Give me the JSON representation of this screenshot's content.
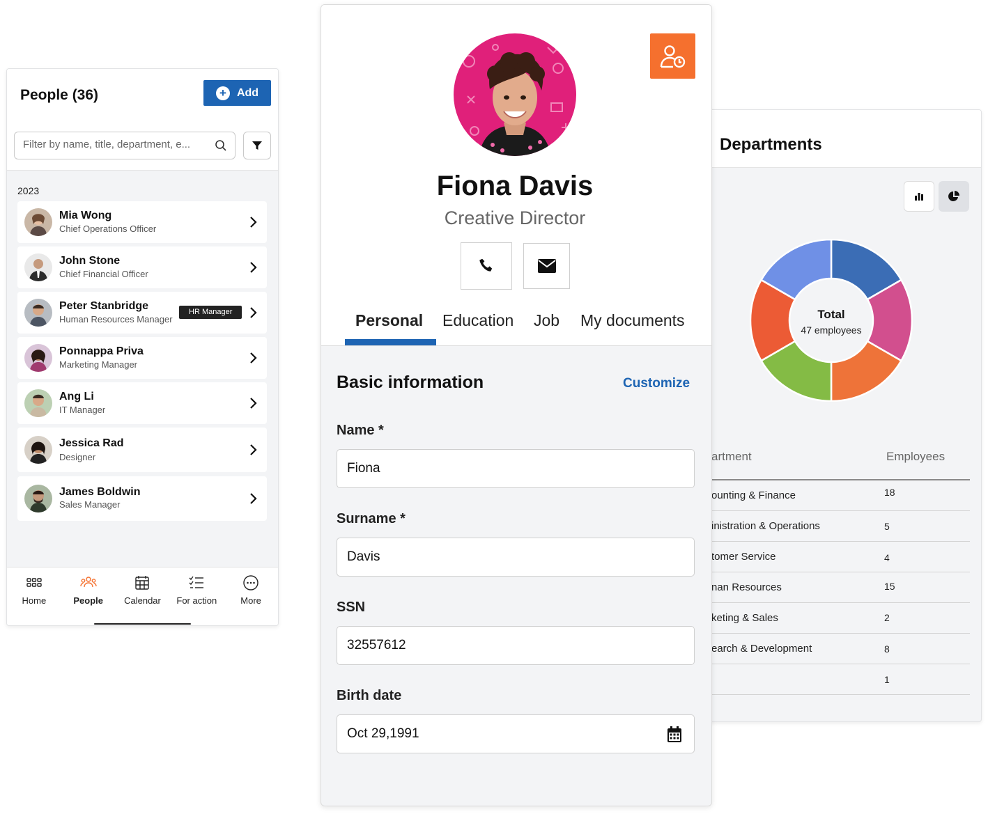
{
  "people": {
    "title": "People (36)",
    "add_label": "Add",
    "filter_placeholder": "Filter by name, title, department, e...",
    "group_year": "2023",
    "items": [
      {
        "name": "Mia Wong",
        "role": "Chief Operations Officer",
        "badge": ""
      },
      {
        "name": "John Stone",
        "role": "Chief Financial Officer",
        "badge": ""
      },
      {
        "name": "Peter Stanbridge",
        "role": "Human Resources Manager",
        "badge": "HR Manager"
      },
      {
        "name": "Ponnappa Priva",
        "role": "Marketing Manager",
        "badge": ""
      },
      {
        "name": "Ang Li",
        "role": "IT Manager",
        "badge": ""
      },
      {
        "name": "Jessica Rad",
        "role": "Designer",
        "badge": ""
      },
      {
        "name": "James Boldwin",
        "role": "Sales Manager",
        "badge": ""
      }
    ],
    "nav": [
      {
        "label": "Home",
        "icon": "grid-icon"
      },
      {
        "label": "People",
        "icon": "people-icon",
        "active": true
      },
      {
        "label": "Calendar",
        "icon": "calendar-icon"
      },
      {
        "label": "For action",
        "icon": "checklist-icon"
      },
      {
        "label": "More",
        "icon": "more-icon"
      }
    ],
    "accent_color": "#1d64b3",
    "active_nav_color": "#f5702e"
  },
  "profile": {
    "name": "Fiona Davis",
    "role": "Creative Director",
    "tabs": [
      "Personal",
      "Education",
      "Job",
      "My documents"
    ],
    "active_tab": "Personal",
    "section_title": "Basic information",
    "customize_label": "Customize",
    "fields": {
      "name": {
        "label": "Name *",
        "value": "Fiona"
      },
      "surname": {
        "label": "Surname *",
        "value": "Davis"
      },
      "ssn": {
        "label": "SSN",
        "value": "32557612"
      },
      "birth": {
        "label": "Birth date",
        "value": "Oct 29,1991"
      }
    },
    "accent_color": "#f5702e"
  },
  "departments": {
    "title": "Departments",
    "center_title": "Total",
    "center_subtitle": "47 employees",
    "table_headers": [
      "artment",
      "Employees"
    ],
    "rows": [
      {
        "dept": "ounting & Finance",
        "count": "18"
      },
      {
        "dept": "inistration & Operations",
        "count": "5"
      },
      {
        "dept": "tomer Service",
        "count": "4"
      },
      {
        "dept": "nan Resources",
        "count": "15"
      },
      {
        "dept": "keting & Sales",
        "count": "2"
      },
      {
        "dept": "earch & Development",
        "count": "8"
      },
      {
        "dept": "",
        "count": "1"
      }
    ]
  },
  "chart_data": {
    "type": "pie",
    "title": "",
    "center_label": "Total",
    "center_sublabel": "47 employees",
    "slices": [
      {
        "color": "#3b6db5",
        "value": 1
      },
      {
        "color": "#d24f8e",
        "value": 1
      },
      {
        "color": "#ee7339",
        "value": 1
      },
      {
        "color": "#84bb45",
        "value": 1
      },
      {
        "color": "#ec5b35",
        "value": 1
      },
      {
        "color": "#6f90e6",
        "value": 1
      }
    ]
  }
}
